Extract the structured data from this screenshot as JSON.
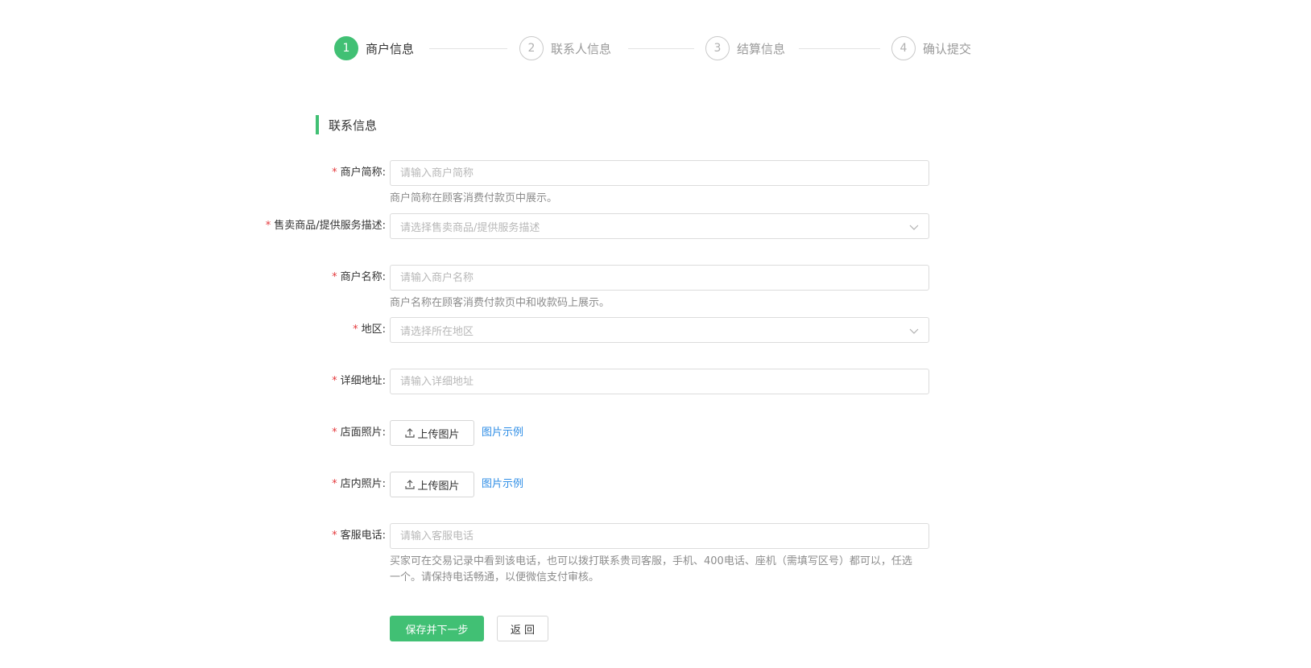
{
  "colors": {
    "accent": "#41c074",
    "required": "#e4393c",
    "link": "#2f8ee6"
  },
  "steps": [
    {
      "number": "1",
      "title": "商户信息",
      "status": "active"
    },
    {
      "number": "2",
      "title": "联系人信息",
      "status": "pending"
    },
    {
      "number": "3",
      "title": "结算信息",
      "status": "pending"
    },
    {
      "number": "4",
      "title": "确认提交",
      "status": "pending"
    }
  ],
  "section": {
    "title": "联系信息"
  },
  "form": {
    "required_mark": "*",
    "merchant_short_name": {
      "label": "商户简称:",
      "placeholder": "请输入商户简称",
      "hint": "商户简称在顾客消费付款页中展示。"
    },
    "product_description": {
      "label": "售卖商品/提供服务描述:",
      "placeholder": "请选择售卖商品/提供服务描述"
    },
    "merchant_name": {
      "label": "商户名称:",
      "placeholder": "请输入商户名称",
      "hint": "商户名称在顾客消费付款页中和收款码上展示。"
    },
    "region": {
      "label": "地区:",
      "placeholder": "请选择所在地区"
    },
    "address": {
      "label": "详细地址:",
      "placeholder": "请输入详细地址"
    },
    "storefront_photo": {
      "label": "店面照片:",
      "upload_label": "上传图片",
      "example_link": "图片示例"
    },
    "interior_photo": {
      "label": "店内照片:",
      "upload_label": "上传图片",
      "example_link": "图片示例"
    },
    "service_phone": {
      "label": "客服电话:",
      "placeholder": "请输入客服电话",
      "hint": "买家可在交易记录中看到该电话，也可以拨打联系贵司客服，手机、400电话、座机（需填写区号）都可以，任选一个。请保持电话畅通，以便微信支付审核。"
    }
  },
  "actions": {
    "save_next_label": "保存并下一步",
    "back_label": "返 回"
  }
}
